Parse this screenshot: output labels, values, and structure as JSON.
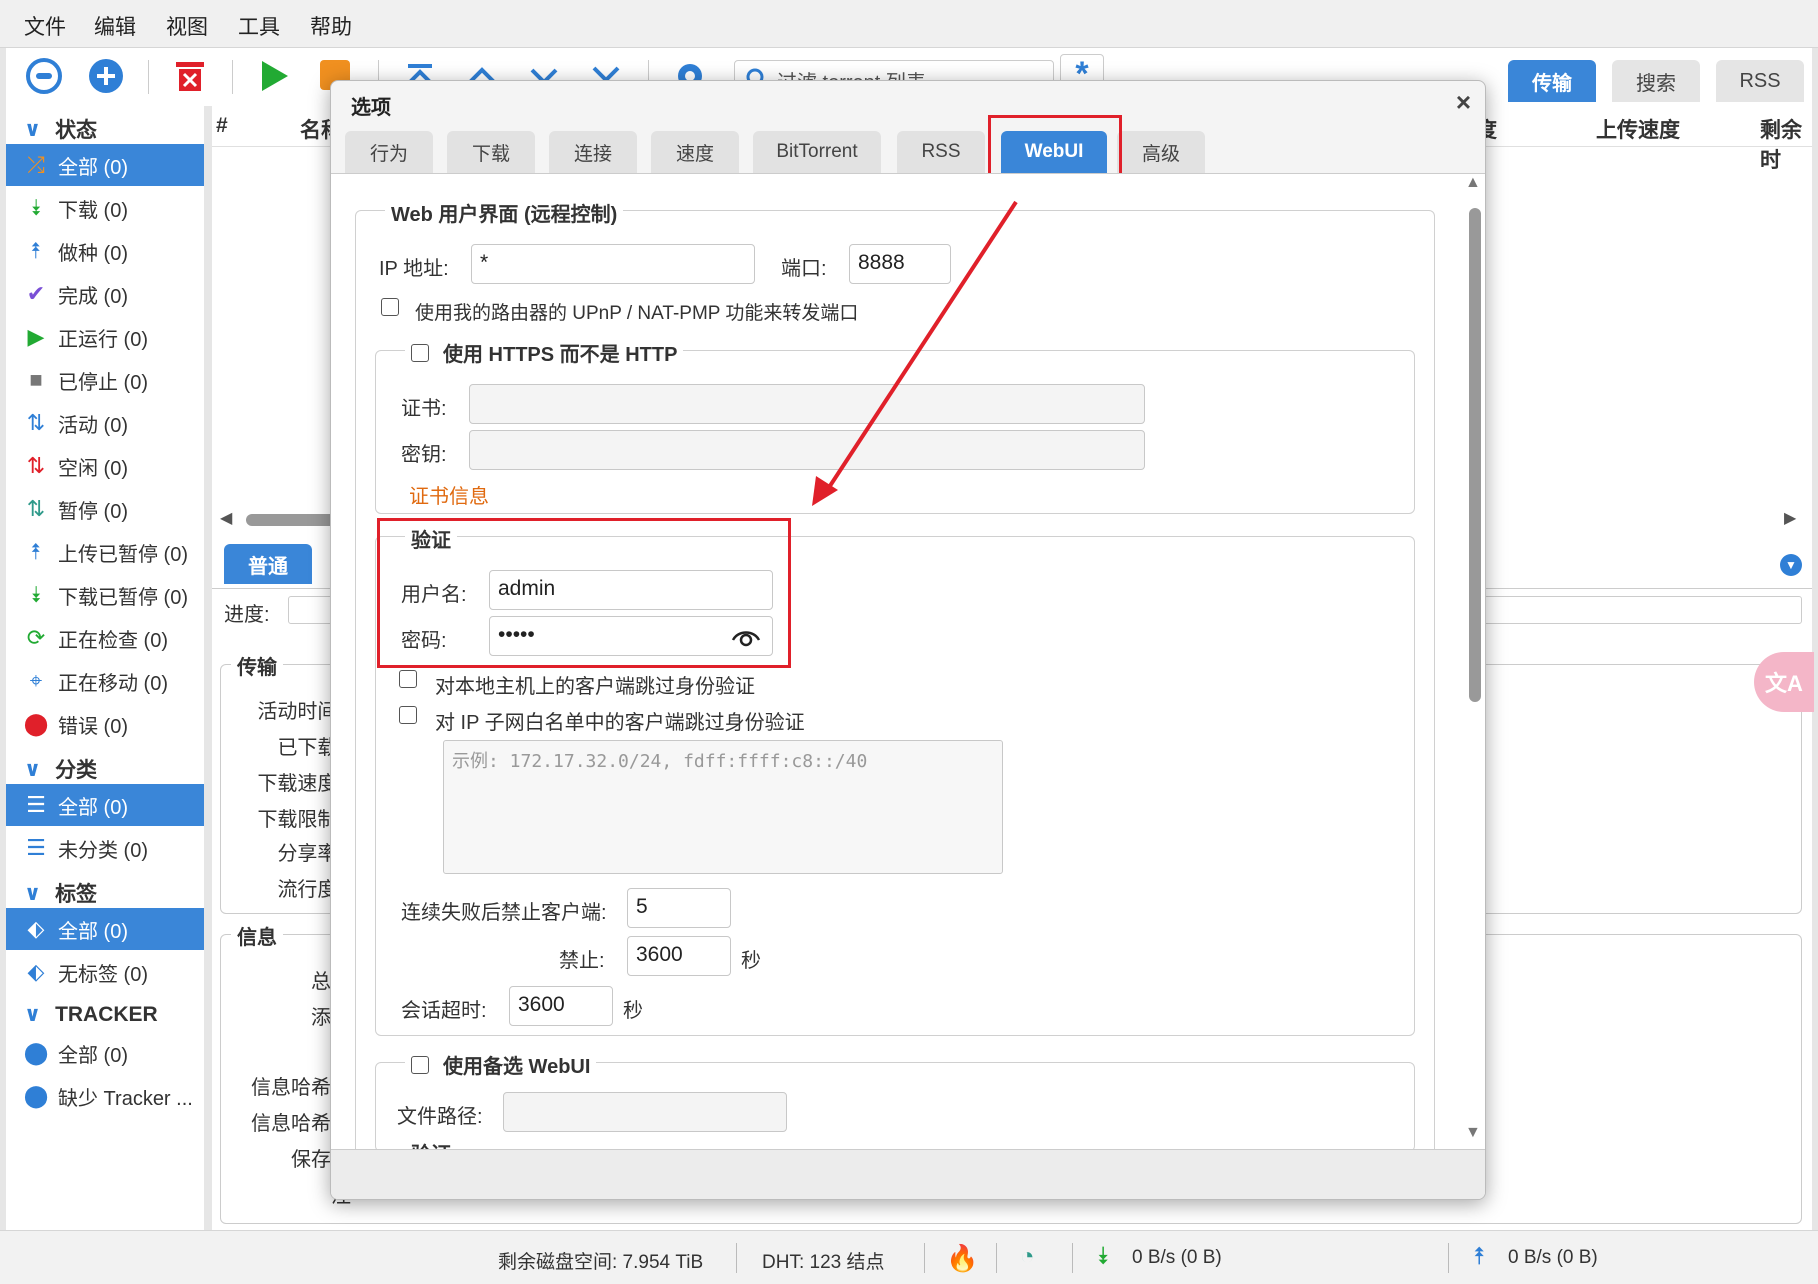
{
  "menu": [
    "文件",
    "编辑",
    "视图",
    "工具",
    "帮助"
  ],
  "toolbar": {
    "filter_placeholder": "过滤 torrent 列表...",
    "right_tabs": [
      "传输",
      "搜索",
      "RSS"
    ]
  },
  "sidebar": {
    "status_title": "状态",
    "status_items": [
      "全部 (0)",
      "下载 (0)",
      "做种 (0)",
      "完成 (0)",
      "正运行 (0)",
      "已停止 (0)",
      "活动 (0)",
      "空闲 (0)",
      "暂停 (0)",
      "上传已暂停 (0)",
      "下载已暂停 (0)",
      "正在检查 (0)",
      "正在移动 (0)",
      "错误 (0)"
    ],
    "category_title": "分类",
    "category_items": [
      "全部 (0)",
      "未分类 (0)"
    ],
    "tag_title": "标签",
    "tag_items": [
      "全部 (0)",
      "无标签 (0)"
    ],
    "tracker_title": "TRACKER",
    "tracker_items": [
      "全部 (0)",
      "缺少 Tracker ..."
    ]
  },
  "main": {
    "columns": [
      "#",
      "名称",
      "度",
      "上传速度",
      "剩余时"
    ],
    "lower_tab": "普通",
    "progress_label": "进度:",
    "transfer_legend": "传输",
    "transfer_labels": [
      "活动时间:",
      "已下载:",
      "下载速度:",
      "下载限制:",
      "分享率:",
      "流行度:"
    ],
    "info_legend": "信息",
    "info_labels": [
      "总大",
      "添加",
      "",
      "信息哈希值",
      "信息哈希值",
      "保存路",
      "注"
    ]
  },
  "statusbar": {
    "free_space": "剩余磁盘空间: 7.954 TiB",
    "dht": "DHT: 123 结点",
    "download": "0 B/s (0 B)",
    "upload": "0 B/s (0 B)"
  },
  "dialog": {
    "title": "选项",
    "close": "×",
    "tabs": [
      "行为",
      "下载",
      "连接",
      "速度",
      "BitTorrent",
      "RSS",
      "WebUI",
      "高级"
    ],
    "webui_legend": "Web 用户界面 (远程控制)",
    "ip_label": "IP 地址:",
    "ip_value": "*",
    "port_label": "端口:",
    "port_value": "8888",
    "upnp_label": "使用我的路由器的 UPnP / NAT-PMP 功能来转发端口",
    "https_legend": "使用 HTTPS 而不是 HTTP",
    "cert_label": "证书:",
    "key_label": "密钥:",
    "cert_info_link": "证书信息",
    "auth_legend": "验证",
    "username_label": "用户名:",
    "username_value": "admin",
    "password_label": "密码:",
    "password_value": "•••••",
    "bypass_local_label": "对本地主机上的客户端跳过身份验证",
    "bypass_subnet_label": "对 IP 子网白名单中的客户端跳过身份验证",
    "subnet_placeholder": "示例: 172.17.32.0/24, fdff:ffff:c8::/40",
    "ban_after_label": "连续失败后禁止客户端:",
    "ban_after_value": "5",
    "ban_label": "禁止:",
    "ban_value": "3600",
    "seconds": "秒",
    "session_timeout_label": "会话超时:",
    "session_timeout_value": "3600",
    "alt_webui_legend": "使用备选 WebUI",
    "file_path_label": "文件路径:",
    "next_legend_partial": "验证"
  },
  "colors": {
    "accent": "#3a86d8",
    "highlight": "#e0202a"
  }
}
